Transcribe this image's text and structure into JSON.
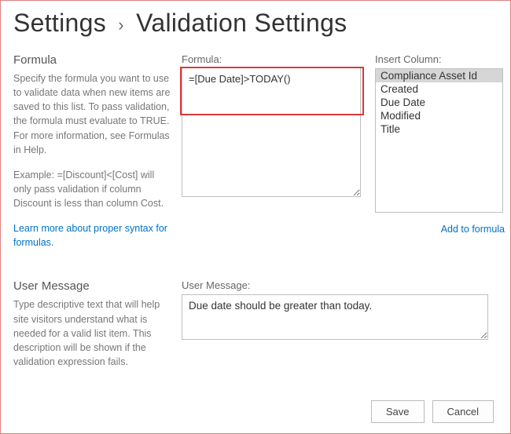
{
  "breadcrumb": {
    "parent": "Settings",
    "current": "Validation Settings"
  },
  "formula_section": {
    "title": "Formula",
    "description": "Specify the formula you want to use to validate data when new items are saved to this list. To pass validation, the formula must evaluate to TRUE. For more information, see Formulas in Help.",
    "example": "Example: =[Discount]<[Cost] will only pass validation if column Discount is less than column Cost.",
    "help_link": "Learn more about proper syntax for formulas.",
    "field_label": "Formula:",
    "value": "=[Due Date]>TODAY()"
  },
  "columns": {
    "label": "Insert Column:",
    "items": [
      "Compliance Asset Id",
      "Created",
      "Due Date",
      "Modified",
      "Title"
    ],
    "selected_index": 0,
    "add_link": "Add to formula"
  },
  "user_message_section": {
    "title": "User Message",
    "description": "Type descriptive text that will help site visitors understand what is needed for a valid list item. This description will be shown if the validation expression fails.",
    "field_label": "User Message:",
    "value": "Due date should be greater than today."
  },
  "buttons": {
    "save": "Save",
    "cancel": "Cancel"
  }
}
